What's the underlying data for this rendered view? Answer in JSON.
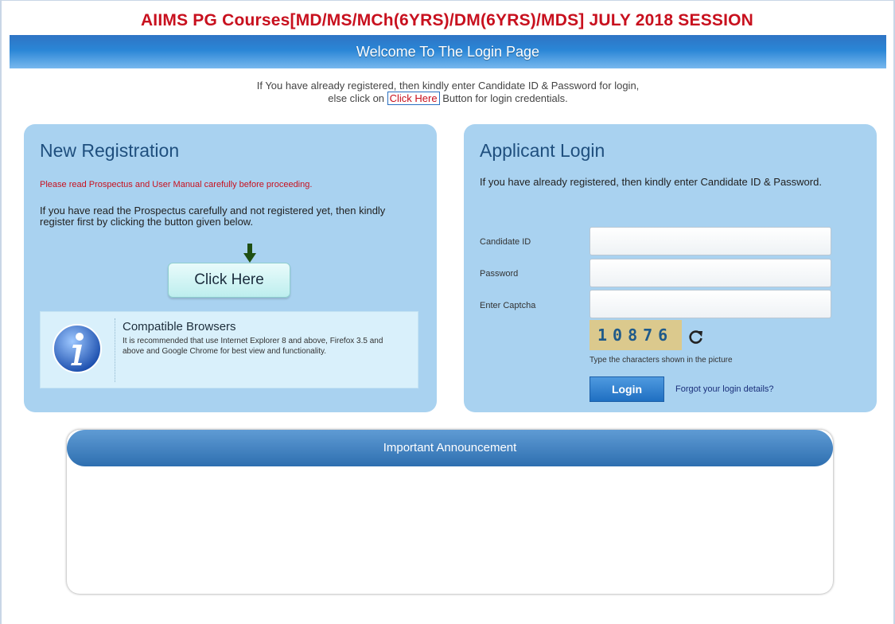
{
  "header": {
    "title": "AIIMS PG Courses[MD/MS/MCh(6YRS)/DM(6YRS)/MDS] JULY 2018 SESSION",
    "welcome": "Welcome To The Login Page"
  },
  "intro": {
    "line1_prefix": "If You have already registered, then kindly enter Candidate ID & Password for login,",
    "line2_prefix": "else click on ",
    "click_here": "Click Here",
    "line2_suffix": " Button for login credentials."
  },
  "registration": {
    "title": "New Registration",
    "note": "Please read Prospectus and User Manual carefully before proceeding.",
    "text": "If you have read the Prospectus carefully and not registered yet, then kindly register first by clicking the button given below.",
    "button": "Click Here",
    "browsers": {
      "title": "Compatible Browsers",
      "text": "It is recommended that use Internet Explorer 8 and above, Firefox 3.5 and above and Google Chrome for best view and functionality."
    }
  },
  "login": {
    "title": "Applicant Login",
    "note": "If you have already registered, then kindly enter Candidate ID & Password.",
    "candidate_id_label": "Candidate ID",
    "password_label": "Password",
    "captcha_label": "Enter Captcha",
    "captcha_value": "10876",
    "captcha_hint": "Type the characters shown in the picture",
    "login_button": "Login",
    "forgot_link": "Forgot your login details?"
  },
  "announcement": {
    "title": "Important Announcement"
  },
  "colors": {
    "title_red": "#c8101e",
    "panel_blue": "#a9d2f0",
    "header_blue": "#2a86d6"
  }
}
